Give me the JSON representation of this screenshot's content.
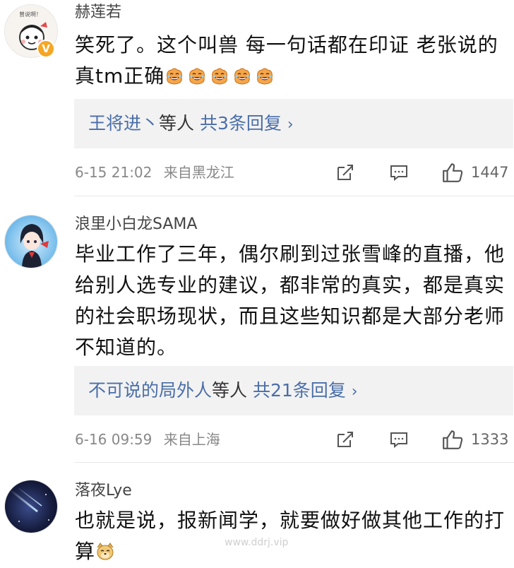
{
  "comments": [
    {
      "username": "赫莲若",
      "text": "笑死了。这个叫兽 每一句话都在印证 老张说的真tm正确",
      "emojis": [
        "laugh-emoji",
        "laugh-emoji",
        "laugh-emoji",
        "laugh-emoji",
        "laugh-emoji"
      ],
      "replies": {
        "names": "王将进丶",
        "deng": "等人",
        "count": "共3条回复",
        "chevron": "›"
      },
      "time": "6-15 21:02",
      "location": "来自黑龙江",
      "likes": "1447"
    },
    {
      "username": "浪里小白龙SAMA",
      "text": "毕业工作了三年，偶尔刷到过张雪峰的直播，他给别人选专业的建议，都非常的真实，都是真实的社会职场现状，而且这些知识都是大部分老师不知道的。",
      "replies": {
        "names": "不可说的局外人",
        "deng": "等人",
        "count": "共21条回复",
        "chevron": "›"
      },
      "time": "6-16 09:59",
      "location": "来自上海",
      "likes": "1333"
    },
    {
      "username": "落夜Lye",
      "text": "也就是说，报新闻学，就要做好做其他工作的打算",
      "emojis": [
        "doge-emoji"
      ]
    }
  ],
  "avatar1_text": "曾说啊！",
  "verified_badge": "V",
  "watermark": "www.ddrj.vip",
  "colors": {
    "link": "#4a6ea9",
    "badge": "#f5a623",
    "reply_bg": "#f2f2f2"
  }
}
